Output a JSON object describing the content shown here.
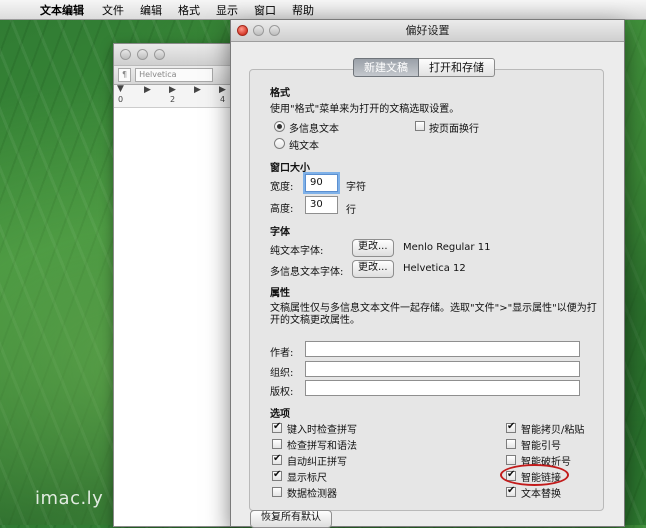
{
  "menubar": {
    "apple": "",
    "app_name": "文本编辑",
    "items": [
      "文件",
      "编辑",
      "格式",
      "显示",
      "窗口",
      "帮助"
    ]
  },
  "doc_window": {
    "paragraph_style": "¶",
    "font": "Helvetica",
    "ruler_labels": [
      "0",
      "2",
      "4"
    ]
  },
  "prefs": {
    "title": "偏好设置",
    "tabs": [
      "新建文稿",
      "打开和存储"
    ],
    "format": {
      "heading": "格式",
      "description": "使用\"格式\"菜单来为打开的文稿选取设置。",
      "rich_text": "多信息文本",
      "plain_text": "纯文本",
      "wrap_to_page": "按页面换行"
    },
    "window_size": {
      "heading": "窗口大小",
      "width_label": "宽度:",
      "width_value": "90",
      "width_unit": "字符",
      "height_label": "高度:",
      "height_value": "30",
      "height_unit": "行"
    },
    "font": {
      "heading": "字体",
      "plain_label": "纯文本字体:",
      "plain_button": "更改...",
      "plain_value": "Menlo Regular 11",
      "rich_label": "多信息文本字体:",
      "rich_button": "更改...",
      "rich_value": "Helvetica 12"
    },
    "properties": {
      "heading": "属性",
      "description_line1": "文稿属性仅与多信息文本文件一起存储。选取\"文件\">\"显示属性\"以便为打",
      "description_line2": "开的文稿更改属性。",
      "author_label": "作者:",
      "org_label": "组织:",
      "copyright_label": "版权:",
      "author_value": "",
      "org_value": "",
      "copyright_value": ""
    },
    "options": {
      "heading": "选项",
      "left": [
        "键入时检查拼写",
        "检查拼写和语法",
        "自动纠正拼写",
        "显示标尺",
        "数据检测器"
      ],
      "right": [
        "智能拷贝/粘贴",
        "智能引号",
        "智能破折号",
        "智能链接",
        "文本替换"
      ]
    },
    "restore_button": "恢复所有默认"
  },
  "watermark": "imac.ly",
  "colors": {
    "highlight": "#c21b1b",
    "focus": "#7fb1e8"
  }
}
